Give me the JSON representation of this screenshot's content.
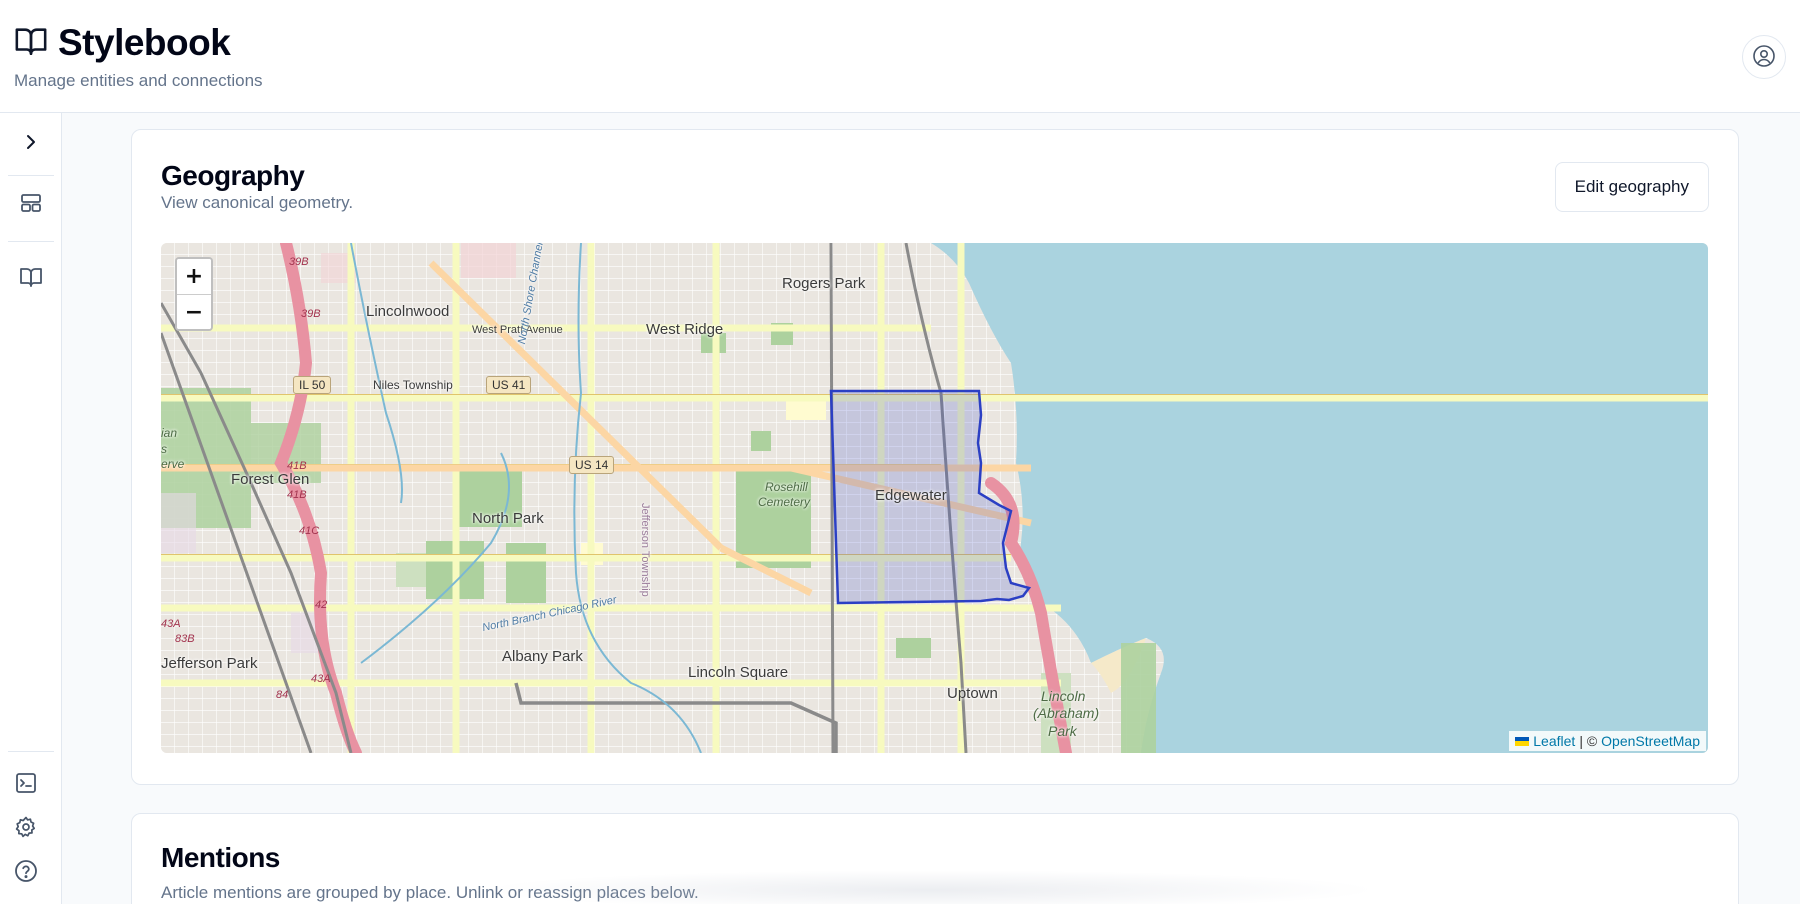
{
  "header": {
    "title": "Stylebook",
    "subtitle": "Manage entities and connections"
  },
  "geography": {
    "title": "Geography",
    "description": "View canonical geometry.",
    "edit_label": "Edit geography",
    "zoom_in_label": "+",
    "zoom_out_label": "−",
    "attribution": {
      "leaflet": "Leaflet",
      "separator": "| ©",
      "osm": "OpenStreetMap"
    },
    "map_labels": {
      "rogers_park": "Rogers Park",
      "lincolnwood": "Lincolnwood",
      "west_pratt": "West Pratt Avenue",
      "west_ridge": "West Ridge",
      "niles_township": "Niles Township",
      "forest_glen": "Forest Glen",
      "north_park": "North Park",
      "rosehill": "Rosehill",
      "cemetery": "Cemetery",
      "edgewater": "Edgewater",
      "albany_park": "Albany Park",
      "lincoln_square": "Lincoln Square",
      "uptown": "Uptown",
      "jefferson_park": "Jefferson Park",
      "lincoln_park_1": "Lincoln",
      "lincoln_park_2": "(Abraham)",
      "lincoln_park_3": "Park",
      "north_shore_channel": "North Shore Channel",
      "north_branch": "North Branch Chicago River",
      "jefferson_township": "Jefferson Township",
      "il50": "IL 50",
      "us41": "US 41",
      "us14": "US 14",
      "r39b_a": "39B",
      "r39b_b": "39B",
      "r41b_a": "41B",
      "r41b_b": "41B",
      "r41c": "41C",
      "r42": "42",
      "r43a_a": "43A",
      "r43a_b": "43A",
      "r83b": "83B",
      "r84": "84",
      "frag_ian": "ian",
      "frag_s": "s",
      "frag_erve": "erve"
    },
    "colors": {
      "water": "#aad3df",
      "land": "#f2efe9",
      "park": "#add19e",
      "highway": "#e892a2",
      "arterial": "#f7fabf",
      "boundary_stroke": "#2b3fc4",
      "boundary_fill": "#3344cc"
    }
  },
  "mentions": {
    "title": "Mentions",
    "description": "Article mentions are grouped by place. Unlink or reassign places below."
  }
}
